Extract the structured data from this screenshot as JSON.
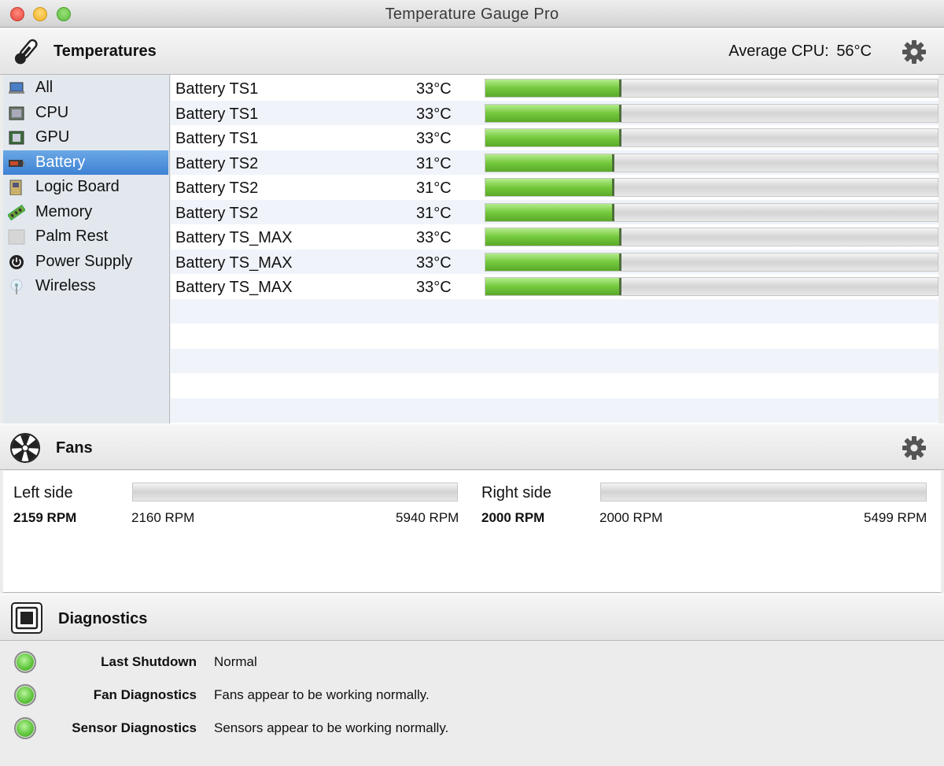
{
  "window": {
    "title": "Temperature Gauge Pro"
  },
  "temperatures": {
    "title": "Temperatures",
    "avg_label": "Average CPU:",
    "avg_value": "56°C",
    "icon": "thermometer-icon",
    "sidebar": [
      {
        "label": "All",
        "icon": "laptop-icon",
        "active": false
      },
      {
        "label": "CPU",
        "icon": "cpu-chip-icon",
        "active": false
      },
      {
        "label": "GPU",
        "icon": "gpu-chip-icon",
        "active": false
      },
      {
        "label": "Battery",
        "icon": "battery-icon",
        "active": true
      },
      {
        "label": "Logic Board",
        "icon": "logic-board-icon",
        "active": false
      },
      {
        "label": "Memory",
        "icon": "memory-stick-icon",
        "active": false
      },
      {
        "label": "Palm Rest",
        "icon": "palm-rest-icon",
        "active": false
      },
      {
        "label": "Power Supply",
        "icon": "power-icon",
        "active": false
      },
      {
        "label": "Wireless",
        "icon": "antenna-icon",
        "active": false
      }
    ],
    "sensors": [
      {
        "name": "Battery TS1",
        "value": "33°C",
        "level": 0.3
      },
      {
        "name": "Battery TS1",
        "value": "33°C",
        "level": 0.3
      },
      {
        "name": "Battery TS1",
        "value": "33°C",
        "level": 0.3
      },
      {
        "name": "Battery TS2",
        "value": "31°C",
        "level": 0.285
      },
      {
        "name": "Battery TS2",
        "value": "31°C",
        "level": 0.285
      },
      {
        "name": "Battery TS2",
        "value": "31°C",
        "level": 0.285
      },
      {
        "name": "Battery TS_MAX",
        "value": "33°C",
        "level": 0.3
      },
      {
        "name": "Battery TS_MAX",
        "value": "33°C",
        "level": 0.3
      },
      {
        "name": "Battery TS_MAX",
        "value": "33°C",
        "level": 0.3
      }
    ]
  },
  "fans": {
    "title": "Fans",
    "icon": "fan-icon",
    "left": {
      "name": "Left side",
      "rpm": "2159 RPM",
      "min": "2160 RPM",
      "max": "5940 RPM",
      "level": 0.0
    },
    "right": {
      "name": "Right side",
      "rpm": "2000 RPM",
      "min": "2000 RPM",
      "max": "5499 RPM",
      "level": 0.0
    }
  },
  "diagnostics": {
    "title": "Diagnostics",
    "icon": "chip-icon",
    "items": [
      {
        "label": "Last Shutdown",
        "value": "Normal",
        "status": "ok"
      },
      {
        "label": "Fan Diagnostics",
        "value": "Fans appear to be working normally.",
        "status": "ok"
      },
      {
        "label": "Sensor Diagnostics",
        "value": "Sensors appear to be working normally.",
        "status": "ok"
      }
    ]
  },
  "colors": {
    "accent": "#3e82d3",
    "ok": "#5ec43a",
    "bar": "#74c83c"
  }
}
